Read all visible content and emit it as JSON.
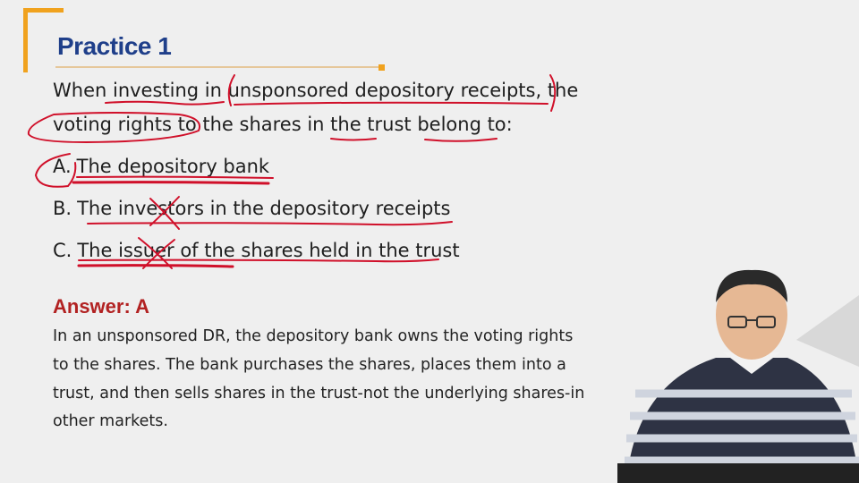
{
  "slide": {
    "title": "Practice 1",
    "question_line1": "When investing in unsponsored depository receipts, the",
    "question_line2": "voting rights to the shares in the trust belong to:",
    "options": [
      {
        "letter": "A.",
        "text": "The depository bank"
      },
      {
        "letter": "B.",
        "text": "The investors in the depository receipts"
      },
      {
        "letter": "C.",
        "text": "The issuer of the shares held in the trust"
      }
    ],
    "answer": "Answer: A",
    "explanation_lines": [
      "In an unsponsored DR, the depository bank owns the voting rights",
      "to the shares. The bank purchases the shares, places them into a",
      "trust, and then sells shares in the trust-not the underlying shares-in",
      "other markets."
    ]
  },
  "colors": {
    "accent": "#f0a21e",
    "title": "#1f3f8a",
    "answer": "#b22222",
    "annotation_ink": "#d0102a"
  }
}
